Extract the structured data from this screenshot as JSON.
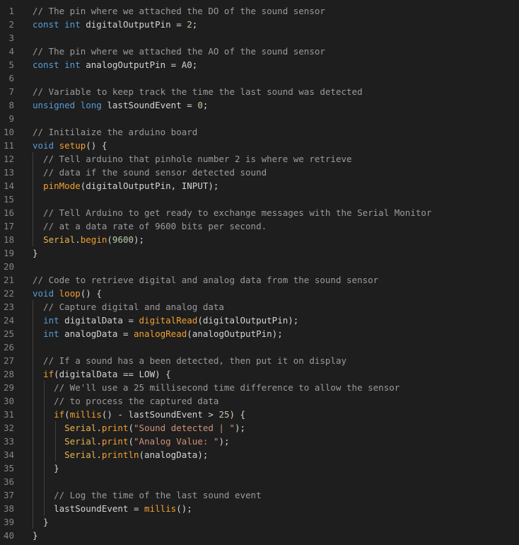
{
  "lines": [
    {
      "n": "1",
      "indent": 0,
      "tokens": [
        {
          "t": "// The pin where we attached the DO of the sound sensor",
          "k": "comment"
        }
      ]
    },
    {
      "n": "2",
      "indent": 0,
      "tokens": [
        {
          "t": "const int",
          "k": "kw"
        },
        {
          "t": " digitalOutputPin = ",
          "k": "id"
        },
        {
          "t": "2",
          "k": "num"
        },
        {
          "t": ";",
          "k": "op"
        }
      ]
    },
    {
      "n": "3",
      "indent": 0,
      "tokens": []
    },
    {
      "n": "4",
      "indent": 0,
      "tokens": [
        {
          "t": "// The pin where we attached the AO of the sound sensor",
          "k": "comment"
        }
      ]
    },
    {
      "n": "5",
      "indent": 0,
      "tokens": [
        {
          "t": "const int",
          "k": "kw"
        },
        {
          "t": " analogOutputPin = A0;",
          "k": "id"
        }
      ]
    },
    {
      "n": "6",
      "indent": 0,
      "tokens": []
    },
    {
      "n": "7",
      "indent": 0,
      "tokens": [
        {
          "t": "// Variable to keep track the time the last sound was detected",
          "k": "comment"
        }
      ]
    },
    {
      "n": "8",
      "indent": 0,
      "tokens": [
        {
          "t": "unsigned long",
          "k": "kw"
        },
        {
          "t": " lastSoundEvent = ",
          "k": "id"
        },
        {
          "t": "0",
          "k": "num"
        },
        {
          "t": ";",
          "k": "op"
        }
      ]
    },
    {
      "n": "9",
      "indent": 0,
      "tokens": []
    },
    {
      "n": "10",
      "indent": 0,
      "tokens": [
        {
          "t": "// Initilaize the arduino board",
          "k": "comment"
        }
      ]
    },
    {
      "n": "11",
      "indent": 0,
      "tokens": [
        {
          "t": "void",
          "k": "kw"
        },
        {
          "t": " ",
          "k": "id"
        },
        {
          "t": "setup",
          "k": "fn2"
        },
        {
          "t": "() {",
          "k": "op"
        }
      ]
    },
    {
      "n": "12",
      "indent": 1,
      "tokens": [
        {
          "t": "  // Tell arduino that pinhole number 2 is where we retrieve",
          "k": "comment"
        }
      ]
    },
    {
      "n": "13",
      "indent": 1,
      "tokens": [
        {
          "t": "  // data if the sound sensor detected sound",
          "k": "comment"
        }
      ]
    },
    {
      "n": "14",
      "indent": 1,
      "tokens": [
        {
          "t": "  ",
          "k": "id"
        },
        {
          "t": "pinMode",
          "k": "fn2"
        },
        {
          "t": "(digitalOutputPin, INPUT);",
          "k": "id"
        }
      ]
    },
    {
      "n": "15",
      "indent": 1,
      "tokens": []
    },
    {
      "n": "16",
      "indent": 1,
      "tokens": [
        {
          "t": "  // Tell Arduino to get ready to exchange messages with the Serial Monitor",
          "k": "comment"
        }
      ]
    },
    {
      "n": "17",
      "indent": 1,
      "tokens": [
        {
          "t": "  // at a data rate of 9600 bits per second.",
          "k": "comment"
        }
      ]
    },
    {
      "n": "18",
      "indent": 1,
      "tokens": [
        {
          "t": "  ",
          "k": "id"
        },
        {
          "t": "Serial",
          "k": "ser"
        },
        {
          "t": ".",
          "k": "op"
        },
        {
          "t": "begin",
          "k": "fn2"
        },
        {
          "t": "(",
          "k": "op"
        },
        {
          "t": "9600",
          "k": "num"
        },
        {
          "t": ");",
          "k": "op"
        }
      ]
    },
    {
      "n": "19",
      "indent": 0,
      "tokens": [
        {
          "t": "}",
          "k": "op"
        }
      ]
    },
    {
      "n": "20",
      "indent": 0,
      "tokens": []
    },
    {
      "n": "21",
      "indent": 0,
      "tokens": [
        {
          "t": "// Code to retrieve digital and analog data from the sound sensor",
          "k": "comment"
        }
      ]
    },
    {
      "n": "22",
      "indent": 0,
      "tokens": [
        {
          "t": "void",
          "k": "kw"
        },
        {
          "t": " ",
          "k": "id"
        },
        {
          "t": "loop",
          "k": "fn2"
        },
        {
          "t": "() {",
          "k": "op"
        }
      ]
    },
    {
      "n": "23",
      "indent": 1,
      "tokens": [
        {
          "t": "  // Capture digital and analog data",
          "k": "comment"
        }
      ]
    },
    {
      "n": "24",
      "indent": 1,
      "tokens": [
        {
          "t": "  ",
          "k": "id"
        },
        {
          "t": "int",
          "k": "kw"
        },
        {
          "t": " digitalData = ",
          "k": "id"
        },
        {
          "t": "digitalRead",
          "k": "fn2"
        },
        {
          "t": "(digitalOutputPin);",
          "k": "id"
        }
      ]
    },
    {
      "n": "25",
      "indent": 1,
      "tokens": [
        {
          "t": "  ",
          "k": "id"
        },
        {
          "t": "int",
          "k": "kw"
        },
        {
          "t": " analogData = ",
          "k": "id"
        },
        {
          "t": "analogRead",
          "k": "fn2"
        },
        {
          "t": "(analogOutputPin);",
          "k": "id"
        }
      ]
    },
    {
      "n": "26",
      "indent": 1,
      "tokens": []
    },
    {
      "n": "27",
      "indent": 1,
      "tokens": [
        {
          "t": "  // If a sound has a been detected, then put it on display",
          "k": "comment"
        }
      ]
    },
    {
      "n": "28",
      "indent": 1,
      "tokens": [
        {
          "t": "  ",
          "k": "id"
        },
        {
          "t": "if",
          "k": "fn2"
        },
        {
          "t": "(digitalData == LOW) {",
          "k": "id"
        }
      ]
    },
    {
      "n": "29",
      "indent": 2,
      "tokens": [
        {
          "t": "    // We'll use a 25 millisecond time difference to allow the sensor",
          "k": "comment"
        }
      ]
    },
    {
      "n": "30",
      "indent": 2,
      "tokens": [
        {
          "t": "    // to process the captured data",
          "k": "comment"
        }
      ]
    },
    {
      "n": "31",
      "indent": 2,
      "tokens": [
        {
          "t": "    ",
          "k": "id"
        },
        {
          "t": "if",
          "k": "fn2"
        },
        {
          "t": "(",
          "k": "op"
        },
        {
          "t": "millis",
          "k": "fn2"
        },
        {
          "t": "() - lastSoundEvent > ",
          "k": "id"
        },
        {
          "t": "25",
          "k": "num"
        },
        {
          "t": ") {",
          "k": "op"
        }
      ]
    },
    {
      "n": "32",
      "indent": 3,
      "tokens": [
        {
          "t": "      ",
          "k": "id"
        },
        {
          "t": "Serial",
          "k": "ser"
        },
        {
          "t": ".",
          "k": "op"
        },
        {
          "t": "print",
          "k": "fn2"
        },
        {
          "t": "(",
          "k": "op"
        },
        {
          "t": "\"Sound detected | \"",
          "k": "str"
        },
        {
          "t": ");",
          "k": "op"
        }
      ]
    },
    {
      "n": "33",
      "indent": 3,
      "tokens": [
        {
          "t": "      ",
          "k": "id"
        },
        {
          "t": "Serial",
          "k": "ser"
        },
        {
          "t": ".",
          "k": "op"
        },
        {
          "t": "print",
          "k": "fn2"
        },
        {
          "t": "(",
          "k": "op"
        },
        {
          "t": "\"Analog Value: \"",
          "k": "str"
        },
        {
          "t": ");",
          "k": "op"
        }
      ]
    },
    {
      "n": "34",
      "indent": 3,
      "tokens": [
        {
          "t": "      ",
          "k": "id"
        },
        {
          "t": "Serial",
          "k": "ser"
        },
        {
          "t": ".",
          "k": "op"
        },
        {
          "t": "println",
          "k": "fn2"
        },
        {
          "t": "(analogData);",
          "k": "id"
        }
      ]
    },
    {
      "n": "35",
      "indent": 2,
      "tokens": [
        {
          "t": "    }",
          "k": "op"
        }
      ]
    },
    {
      "n": "36",
      "indent": 2,
      "tokens": []
    },
    {
      "n": "37",
      "indent": 2,
      "tokens": [
        {
          "t": "    // Log the time of the last sound event",
          "k": "comment"
        }
      ]
    },
    {
      "n": "38",
      "indent": 2,
      "tokens": [
        {
          "t": "    lastSoundEvent = ",
          "k": "id"
        },
        {
          "t": "millis",
          "k": "fn2"
        },
        {
          "t": "();",
          "k": "op"
        }
      ]
    },
    {
      "n": "39",
      "indent": 1,
      "tokens": [
        {
          "t": "  }",
          "k": "op"
        }
      ]
    },
    {
      "n": "40",
      "indent": 0,
      "tokens": [
        {
          "t": "}",
          "k": "op"
        }
      ]
    }
  ]
}
